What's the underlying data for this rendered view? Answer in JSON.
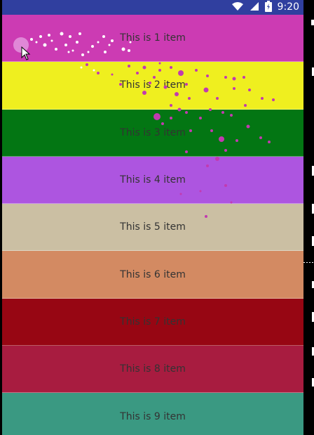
{
  "status_bar": {
    "time": "9:20",
    "icons": [
      "wifi-icon",
      "signal-icon",
      "battery-icon"
    ],
    "background": "#303f9f"
  },
  "list": {
    "items": [
      {
        "label": "This is 1 item",
        "color": "#cc3bb3"
      },
      {
        "label": "This is 2 item",
        "color": "#efef1f"
      },
      {
        "label": "This is 3 item",
        "color": "#037613"
      },
      {
        "label": "This is 4 item",
        "color": "#ad55e0"
      },
      {
        "label": "This is 5 item",
        "color": "#cbbfa3"
      },
      {
        "label": "This is 6 item",
        "color": "#d38a62"
      },
      {
        "label": "This is 7 item",
        "color": "#970613"
      },
      {
        "label": "This is 8 item",
        "color": "#a81c40"
      },
      {
        "label": "This is 9 item",
        "color": "#3a9982"
      }
    ]
  }
}
